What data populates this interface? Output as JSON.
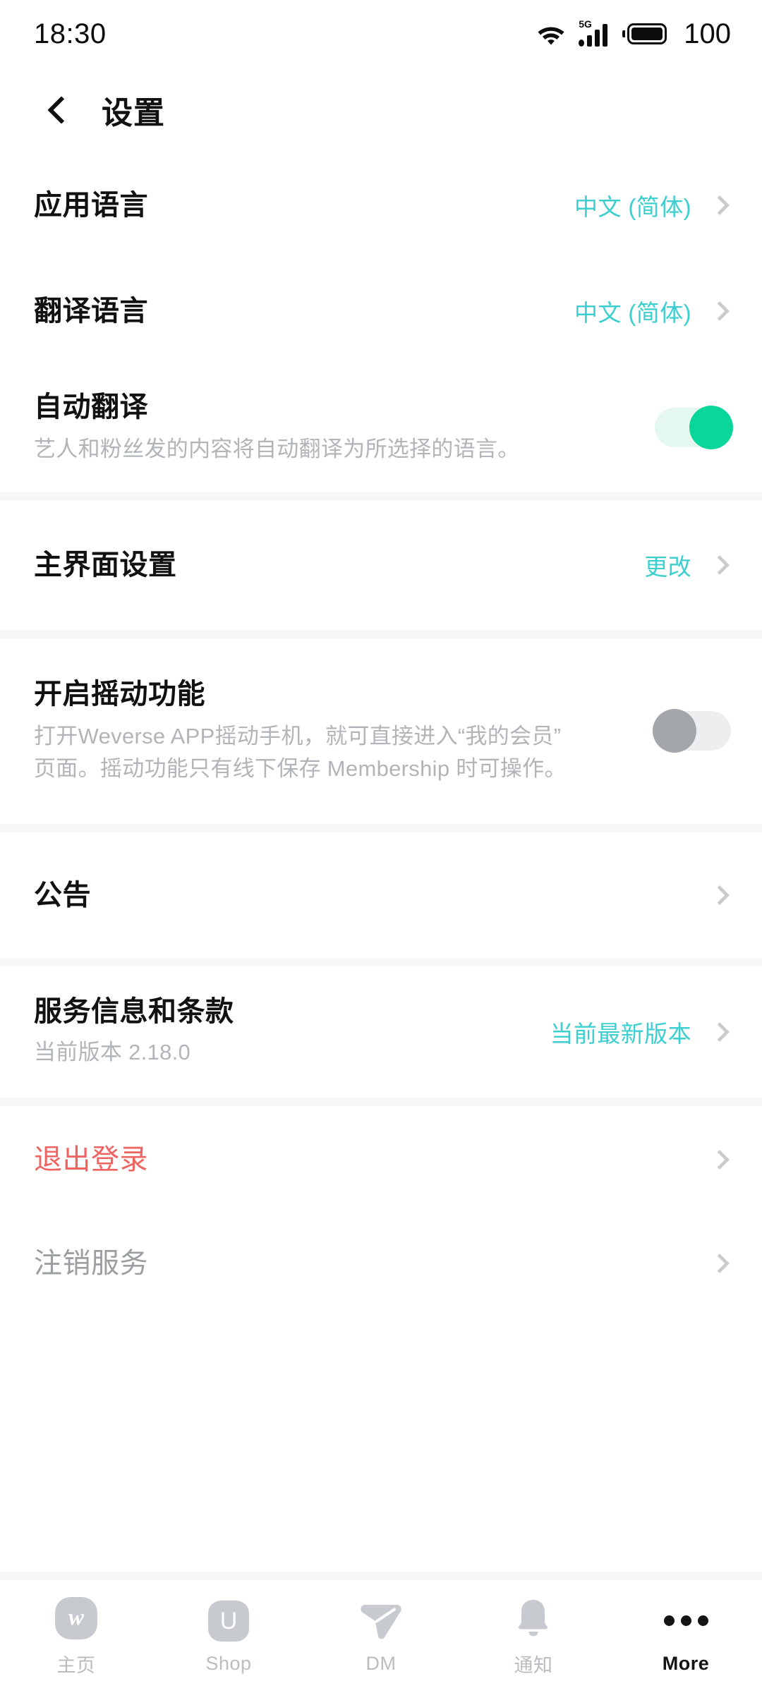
{
  "status_bar": {
    "time": "18:30",
    "battery_percent": "100",
    "network_label": "5G",
    "icons": [
      "wifi-icon",
      "signal-5g-icon",
      "battery-icon"
    ]
  },
  "header": {
    "back_icon": "chevron-left-icon",
    "title": "设置"
  },
  "settings": {
    "app_language": {
      "title": "应用语言",
      "value": "中文 (简体)"
    },
    "translate_language": {
      "title": "翻译语言",
      "value": "中文 (简体)"
    },
    "auto_translate": {
      "title": "自动翻译",
      "description": "艺人和粉丝发的内容将自动翻译为所选择的语言。",
      "toggle_state": "on"
    },
    "main_ui": {
      "title": "主界面设置",
      "value": "更改"
    },
    "shake": {
      "title": "开启摇动功能",
      "description": "打开Weverse APP摇动手机，就可直接进入“我的会员”页面。摇动功能只有线下保存 Membership 时可操作。",
      "toggle_state": "off"
    },
    "notice": {
      "title": "公告"
    },
    "terms": {
      "title": "服务信息和条款",
      "subtitle": "当前版本 2.18.0",
      "value": "当前最新版本"
    },
    "logout": {
      "title": "退出登录"
    },
    "withdraw": {
      "title": "注销服务"
    }
  },
  "bottom_nav": {
    "items": [
      {
        "label": "主页",
        "icon": "weverse-home-icon",
        "active": false
      },
      {
        "label": "Shop",
        "icon": "shop-u-icon",
        "active": false
      },
      {
        "label": "DM",
        "icon": "paper-plane-icon",
        "active": false
      },
      {
        "label": "通知",
        "icon": "bell-icon",
        "active": false
      },
      {
        "label": "More",
        "icon": "ellipsis-icon",
        "active": true
      }
    ]
  },
  "colors": {
    "accent_teal": "#3dcfd0",
    "toggle_on_green": "#08d69a",
    "danger_red": "#ef6360",
    "muted_gray": "#b1b5b9",
    "divider": "#f6f7f8"
  }
}
